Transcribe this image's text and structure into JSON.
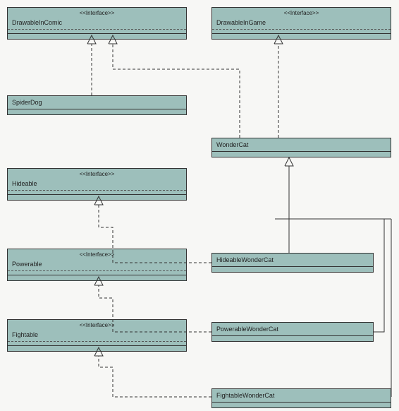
{
  "stereotype_label": "<<Interface>>",
  "interfaces": {
    "drawableInComic": "DrawableInComic",
    "drawableInGame": "DrawableInGame",
    "hideable": "Hideable",
    "powerable": "Powerable",
    "fightable": "Fightable"
  },
  "classes": {
    "spiderDog": "SpiderDog",
    "wonderCat": "WonderCat",
    "hideableWonderCat": "HideableWonderCat",
    "powerableWonderCat": "PowerableWonderCat",
    "fightableWonderCat": "FightableWonderCat"
  },
  "chart_data": {
    "type": "uml-class-diagram",
    "nodes": [
      {
        "id": "DrawableInComic",
        "kind": "interface"
      },
      {
        "id": "DrawableInGame",
        "kind": "interface"
      },
      {
        "id": "Hideable",
        "kind": "interface"
      },
      {
        "id": "Powerable",
        "kind": "interface"
      },
      {
        "id": "Fightable",
        "kind": "interface"
      },
      {
        "id": "SpiderDog",
        "kind": "class"
      },
      {
        "id": "WonderCat",
        "kind": "class"
      },
      {
        "id": "HideableWonderCat",
        "kind": "class"
      },
      {
        "id": "PowerableWonderCat",
        "kind": "class"
      },
      {
        "id": "FightableWonderCat",
        "kind": "class"
      }
    ],
    "edges": [
      {
        "from": "SpiderDog",
        "to": "DrawableInComic",
        "type": "realization"
      },
      {
        "from": "WonderCat",
        "to": "DrawableInComic",
        "type": "realization"
      },
      {
        "from": "WonderCat",
        "to": "DrawableInGame",
        "type": "realization"
      },
      {
        "from": "HideableWonderCat",
        "to": "Hideable",
        "type": "realization"
      },
      {
        "from": "PowerableWonderCat",
        "to": "Powerable",
        "type": "realization"
      },
      {
        "from": "FightableWonderCat",
        "to": "Fightable",
        "type": "realization"
      },
      {
        "from": "HideableWonderCat",
        "to": "WonderCat",
        "type": "generalization"
      },
      {
        "from": "PowerableWonderCat",
        "to": "WonderCat",
        "type": "generalization"
      },
      {
        "from": "FightableWonderCat",
        "to": "WonderCat",
        "type": "generalization"
      }
    ]
  }
}
